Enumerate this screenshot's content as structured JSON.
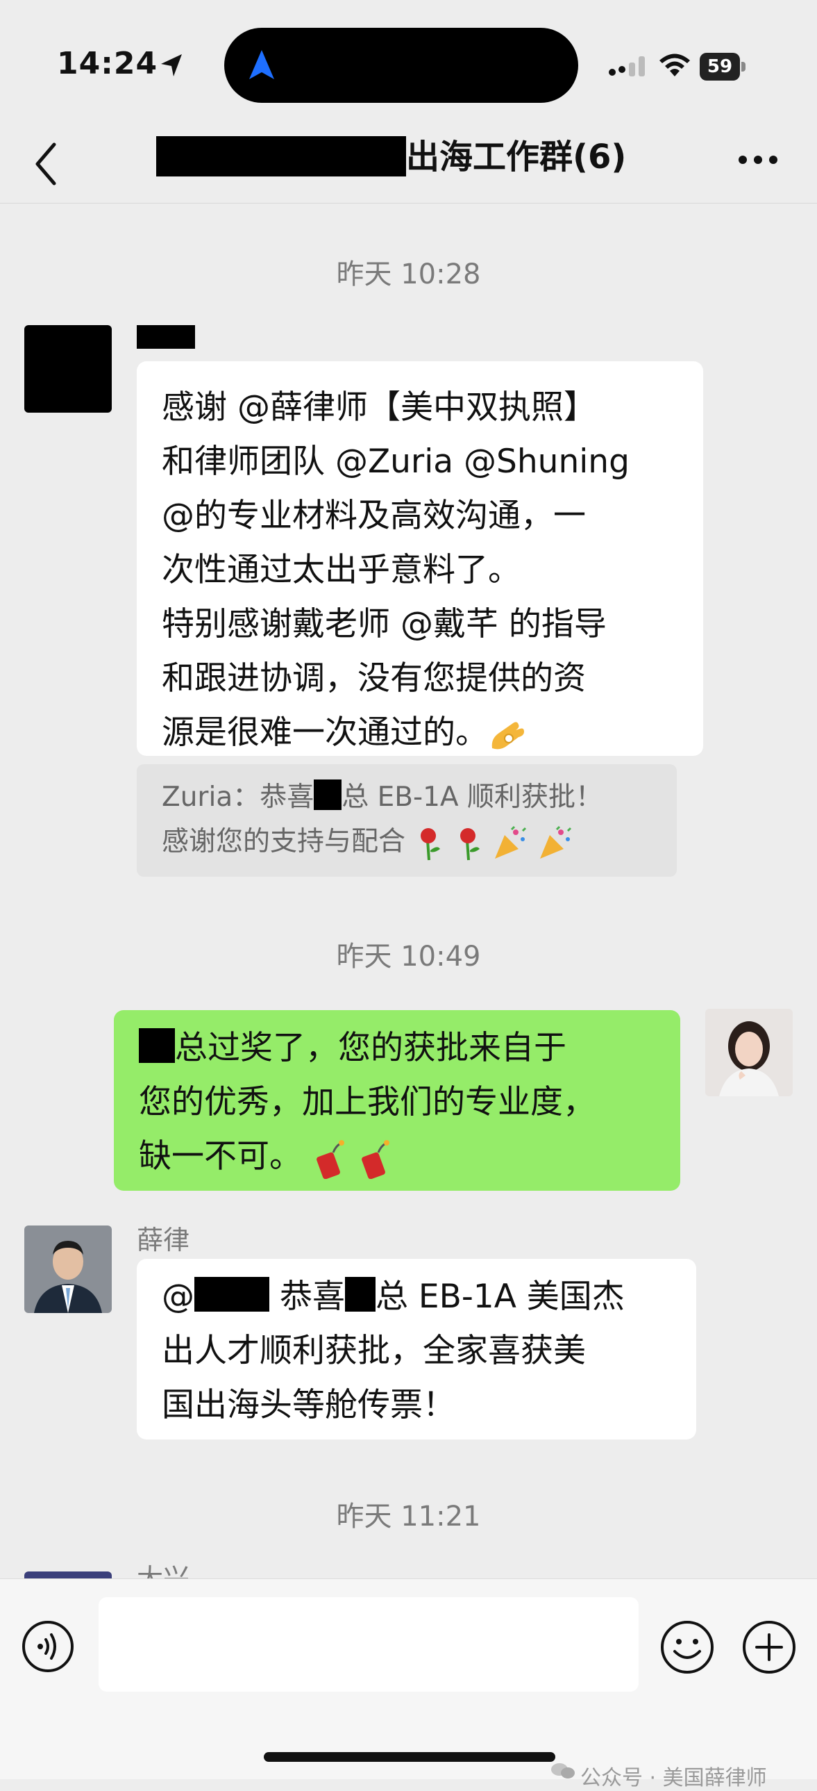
{
  "status_bar": {
    "time": "14:24",
    "battery": "59"
  },
  "nav": {
    "title": "出海工作群(6)"
  },
  "timestamps": [
    "昨天 10:28",
    "昨天 10:49",
    "昨天 11:21"
  ],
  "messages": {
    "m1": {
      "lines": [
        "感谢 @薛律师【美中双执照】",
        "和律师团队 @Zuria @Shuning",
        " @的专业材料及高效沟通，一",
        "次性通过太出乎意料了。",
        "特别感谢戴老师 @戴芊 的指导",
        "和跟进协调，没有您提供的资",
        "源是很难一次通过的。"
      ],
      "quote": {
        "line1_pre": "Zuria：恭喜",
        "line1_post": "总 EB-1A 顺利获批！",
        "line2": "感谢您的支持与配合"
      }
    },
    "m2": {
      "line1_post": "总过奖了，您的获批来自于",
      "line2": "您的优秀，加上我们的专业度，",
      "line3": "缺一不可。"
    },
    "m3": {
      "sender": "薛律",
      "line1_pre": "@",
      "line1_mid": " 恭喜",
      "line1_post": "总 EB-1A 美国杰",
      "line2": "出人才顺利获批，全家喜获美",
      "line3": "国出海头等舱传票！"
    },
    "m4": {
      "sender_partial": "大兴"
    }
  },
  "watermark": "公众号 · 美国薛律师",
  "icons": {
    "back": "back-chevron-icon",
    "more": "more-dots-icon",
    "voice": "voice-icon",
    "emoji": "emoji-icon",
    "plus": "plus-icon",
    "ok_hand": "ok-hand-emoji",
    "rose": "rose-emoji",
    "party": "party-popper-emoji",
    "firecracker": "firecracker-emoji"
  },
  "colors": {
    "background": "#ededed",
    "bubble_self": "#95ec69",
    "bubble_other": "#ffffff"
  }
}
